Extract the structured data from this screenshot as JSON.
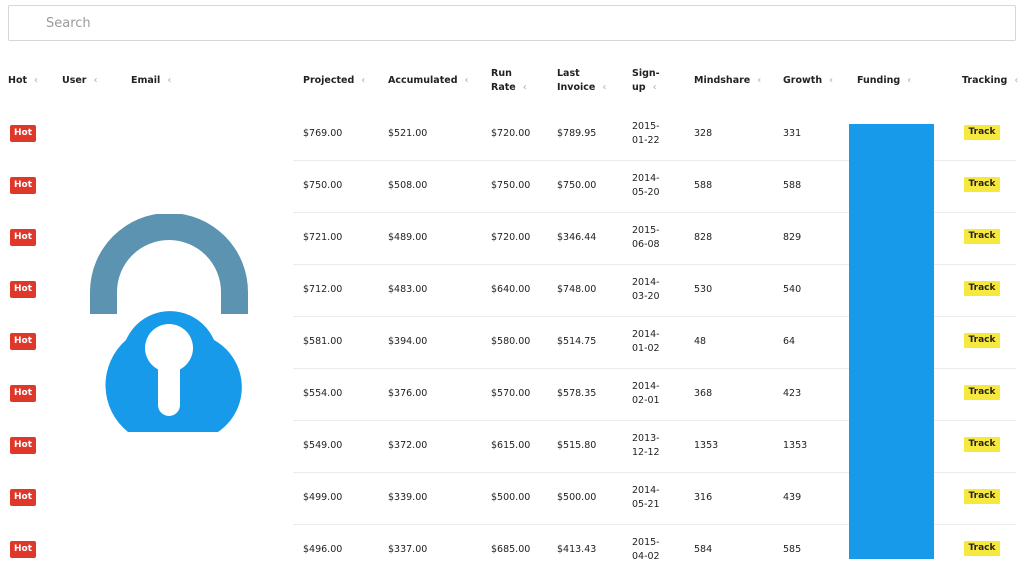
{
  "search": {
    "placeholder": "Search",
    "value": ""
  },
  "columns": [
    {
      "key": "hot",
      "label": "Hot"
    },
    {
      "key": "user",
      "label": "User"
    },
    {
      "key": "email",
      "label": "Email"
    },
    {
      "key": "projected",
      "label": "Projected"
    },
    {
      "key": "accumulated",
      "label": "Accumulated"
    },
    {
      "key": "run_rate",
      "label_lines": [
        "Run",
        "Rate"
      ]
    },
    {
      "key": "last_invoice",
      "label_lines": [
        "Last",
        "Invoice"
      ]
    },
    {
      "key": "signup",
      "label_lines": [
        "Sign-",
        "up"
      ]
    },
    {
      "key": "mindshare",
      "label": "Mindshare"
    },
    {
      "key": "growth",
      "label": "Growth"
    },
    {
      "key": "funding",
      "label": "Funding"
    },
    {
      "key": "tracking",
      "label": "Tracking"
    }
  ],
  "rows": [
    {
      "hot": "Hot",
      "projected": "$769.00",
      "accumulated": "$521.00",
      "run_rate": "$720.00",
      "last_invoice": "$789.95",
      "signup": [
        "2015-",
        "01-22"
      ],
      "mindshare": "328",
      "growth": "331",
      "tracking": "Track"
    },
    {
      "hot": "Hot",
      "projected": "$750.00",
      "accumulated": "$508.00",
      "run_rate": "$750.00",
      "last_invoice": "$750.00",
      "signup": [
        "2014-",
        "05-20"
      ],
      "mindshare": "588",
      "growth": "588",
      "tracking": "Track"
    },
    {
      "hot": "Hot",
      "projected": "$721.00",
      "accumulated": "$489.00",
      "run_rate": "$720.00",
      "last_invoice": "$346.44",
      "signup": [
        "2015-",
        "06-08"
      ],
      "mindshare": "828",
      "growth": "829",
      "tracking": "Track"
    },
    {
      "hot": "Hot",
      "projected": "$712.00",
      "accumulated": "$483.00",
      "run_rate": "$640.00",
      "last_invoice": "$748.00",
      "signup": [
        "2014-",
        "03-20"
      ],
      "mindshare": "530",
      "growth": "540",
      "tracking": "Track"
    },
    {
      "hot": "Hot",
      "projected": "$581.00",
      "accumulated": "$394.00",
      "run_rate": "$580.00",
      "last_invoice": "$514.75",
      "signup": [
        "2014-",
        "01-02"
      ],
      "mindshare": "48",
      "growth": "64",
      "tracking": "Track"
    },
    {
      "hot": "Hot",
      "projected": "$554.00",
      "accumulated": "$376.00",
      "run_rate": "$570.00",
      "last_invoice": "$578.35",
      "signup": [
        "2014-",
        "02-01"
      ],
      "mindshare": "368",
      "growth": "423",
      "tracking": "Track"
    },
    {
      "hot": "Hot",
      "projected": "$549.00",
      "accumulated": "$372.00",
      "run_rate": "$615.00",
      "last_invoice": "$515.80",
      "signup": [
        "2013-",
        "12-12"
      ],
      "mindshare": "1353",
      "growth": "1353",
      "tracking": "Track"
    },
    {
      "hot": "Hot",
      "projected": "$499.00",
      "accumulated": "$339.00",
      "run_rate": "$500.00",
      "last_invoice": "$500.00",
      "signup": [
        "2014-",
        "05-21"
      ],
      "mindshare": "316",
      "growth": "439",
      "tracking": "Track"
    },
    {
      "hot": "Hot",
      "projected": "$496.00",
      "accumulated": "$337.00",
      "run_rate": "$685.00",
      "last_invoice": "$413.43",
      "signup": [
        "2015-",
        "04-02"
      ],
      "mindshare": "584",
      "growth": "585",
      "tracking": "Track"
    }
  ],
  "icons": {
    "sort": "chevron-left-icon",
    "overlay": "cloud-lock-icon"
  },
  "colors": {
    "hot_badge": "#e0372b",
    "track_badge": "#f7e83e",
    "funding_bar": "#179aea",
    "lock_shackle": "#5b93b0",
    "lock_body": "#179aea"
  }
}
